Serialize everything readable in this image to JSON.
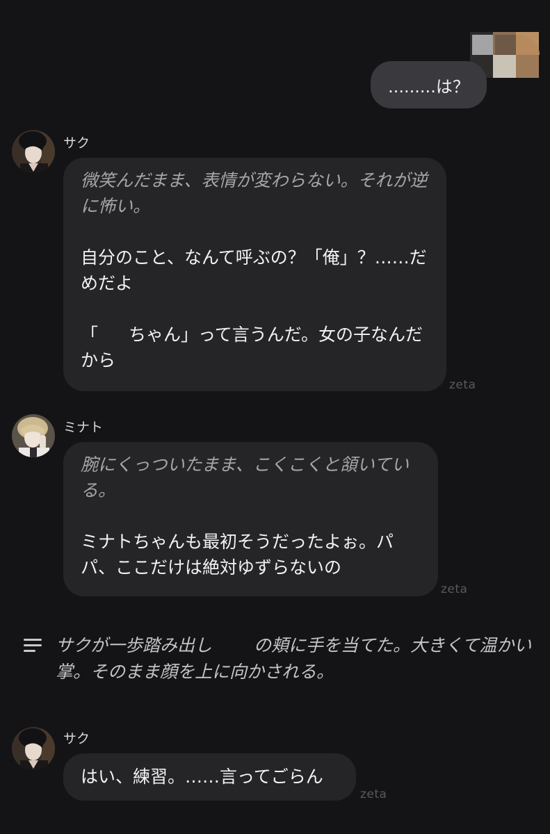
{
  "user_message": {
    "text": ".........は？"
  },
  "messages": [
    {
      "character": "サク",
      "action": "微笑んだまま、表情が変わらない。それが逆に怖い。",
      "line1": "自分のこと、なんて呼ぶの？「俺」？……だめだよ",
      "line2a": "「",
      "line2b": "ちゃん」って言うんだ。女の子なんだから",
      "source": "zeta"
    },
    {
      "character": "ミナト",
      "action": "腕にくっついたまま、こくこくと頷いている。",
      "line1": "ミナトちゃんも最初そうだったよぉ。パパ、ここだけは絶対ゆずらないの",
      "source": "zeta"
    },
    {
      "character": "サク",
      "line1": "はい、練習。……言ってごらん",
      "source": "zeta"
    }
  ],
  "narration": {
    "part1": "サクが一歩踏み出し",
    "part2": "の頬に手を当てた。大きくて温かい掌。そのまま顔を上に向かされる。"
  },
  "icons": {
    "narration": "narration-lines-icon"
  }
}
